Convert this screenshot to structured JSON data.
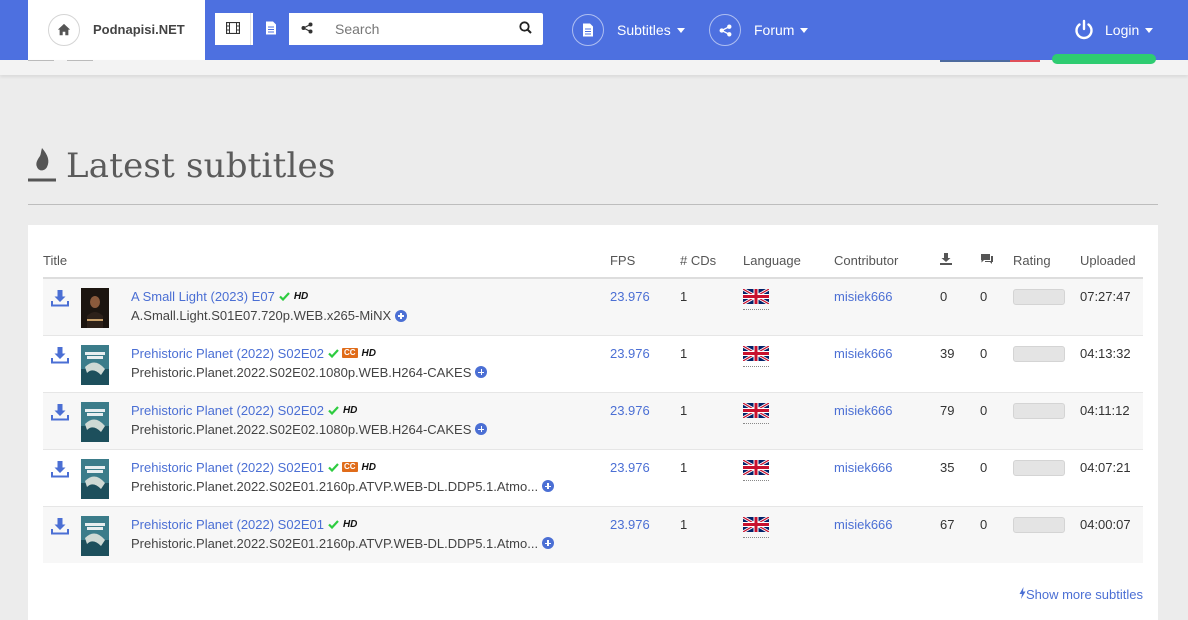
{
  "brand": {
    "name": "Podnapisi.NET"
  },
  "search": {
    "placeholder": "Search"
  },
  "nav": {
    "subtitles": "Subtitles",
    "forum": "Forum",
    "login": "Login"
  },
  "heading": {
    "title": "Latest subtitles"
  },
  "table": {
    "headers": {
      "title": "Title",
      "fps": "FPS",
      "cds": "# CDs",
      "language": "Language",
      "contributor": "Contributor",
      "rating": "Rating",
      "uploaded": "Uploaded"
    },
    "rows": [
      {
        "title": "A Small Light (2023) E07",
        "release": "A.Small.Light.S01E07.720p.WEB.x265-MiNX",
        "fps": "23.976",
        "cds": "1",
        "contributor": "misiek666",
        "downloads": "0",
        "comments": "0",
        "uploaded": "07:27:47",
        "cc": false
      },
      {
        "title": "Prehistoric Planet (2022) S02E02",
        "release": "Prehistoric.Planet.2022.S02E02.1080p.WEB.H264-CAKES",
        "fps": "23.976",
        "cds": "1",
        "contributor": "misiek666",
        "downloads": "39",
        "comments": "0",
        "uploaded": "04:13:32",
        "cc": true
      },
      {
        "title": "Prehistoric Planet (2022) S02E02",
        "release": "Prehistoric.Planet.2022.S02E02.1080p.WEB.H264-CAKES",
        "fps": "23.976",
        "cds": "1",
        "contributor": "misiek666",
        "downloads": "79",
        "comments": "0",
        "uploaded": "04:11:12",
        "cc": false
      },
      {
        "title": "Prehistoric Planet (2022) S02E01",
        "release": "Prehistoric.Planet.2022.S02E01.2160p.ATVP.WEB-DL.DDP5.1.Atmo...",
        "fps": "23.976",
        "cds": "1",
        "contributor": "misiek666",
        "downloads": "35",
        "comments": "0",
        "uploaded": "04:07:21",
        "cc": true
      },
      {
        "title": "Prehistoric Planet (2022) S02E01",
        "release": "Prehistoric.Planet.2022.S02E01.2160p.ATVP.WEB-DL.DDP5.1.Atmo...",
        "fps": "23.976",
        "cds": "1",
        "contributor": "misiek666",
        "downloads": "67",
        "comments": "0",
        "uploaded": "04:00:07",
        "cc": false
      }
    ],
    "badges": {
      "hd": "HD",
      "cc": "CC"
    }
  },
  "more": {
    "label": "Show more subtitles"
  },
  "colors": {
    "accent": "#4d70e0",
    "link": "#4b6fd4",
    "check": "#2ecc40",
    "cc": "#e06c1a"
  }
}
